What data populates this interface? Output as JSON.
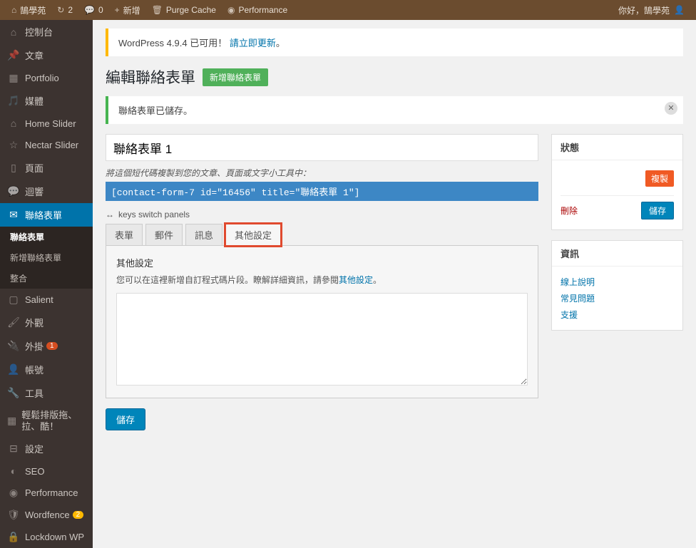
{
  "adminbar": {
    "site": "鵠學苑",
    "updates": "2",
    "comments": "0",
    "new": "新增",
    "purge": "Purge Cache",
    "perf": "Performance",
    "greeting": "你好，鵠學苑"
  },
  "menu": {
    "dashboard": "控制台",
    "posts": "文章",
    "portfolio": "Portfolio",
    "media": "媒體",
    "homeslider": "Home Slider",
    "nectarslider": "Nectar Slider",
    "pages": "頁面",
    "comments": "迴響",
    "contact": "聯絡表單",
    "sub_list": "聯絡表單",
    "sub_new": "新增聯絡表單",
    "sub_int": "整合",
    "salient": "Salient",
    "appearance": "外觀",
    "plugins": "外掛",
    "plugins_badge": "1",
    "users": "帳號",
    "tools": "工具",
    "easywp": "輕鬆排版拖、拉、酷！",
    "settings": "設定",
    "seo": "SEO",
    "perf": "Performance",
    "wordfence": "Wordfence",
    "wordfence_badge": "2",
    "lockdown": "Lockdown WP"
  },
  "notice_update": {
    "pre": "WordPress 4.9.4 已可用！",
    "link": "請立即更新",
    "post": "。"
  },
  "page": {
    "title": "編輯聯絡表單",
    "add": "新增聯絡表單",
    "saved": "聯絡表單已儲存。"
  },
  "form": {
    "name": "聯絡表單 1",
    "hint": "將這個短代碼複製到您的文章、頁面或文字小工具中：",
    "shortcode": "[contact-form-7 id=\"16456\" title=\"聯絡表單 1\"]",
    "keys": "keys switch panels",
    "tabs": {
      "form": "表單",
      "mail": "郵件",
      "messages": "訊息",
      "other": "其他設定"
    },
    "panel_title": "其他設定",
    "panel_desc_pre": "您可以在這裡新增自訂程式碼片段。瞭解詳細資訊，請參閱",
    "panel_desc_link": "其他設定",
    "panel_desc_post": "。",
    "save": "儲存"
  },
  "side": {
    "status": "狀態",
    "copy": "複製",
    "delete": "刪除",
    "save": "儲存",
    "info": "資訊",
    "doc": "線上說明",
    "faq": "常見問題",
    "support": "支援"
  }
}
